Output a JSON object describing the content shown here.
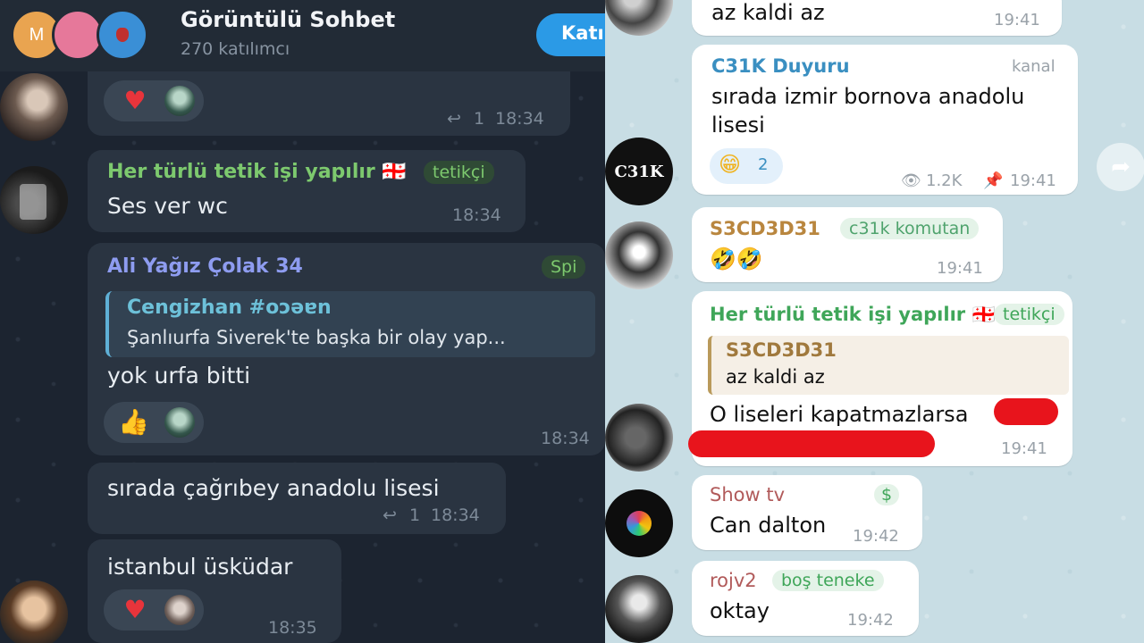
{
  "left": {
    "header": {
      "title": "Görüntülü Sohbet",
      "subtitle": "270 katılımcı",
      "join_label": "Katıl",
      "avatar_letter": "M"
    },
    "messages": [
      {
        "reply_count": "1",
        "time": "18:34"
      },
      {
        "sender": "Her türlü tetik işi yapılır 🇬🇪",
        "tag": "tetikçi",
        "text": "Ses ver wc",
        "time": "18:34"
      },
      {
        "sender": "Ali Yağız Çolak 34",
        "tag": "Spi",
        "quote_sender": "Cengizhan #oɔəɐn",
        "quote_text": "Şanlıurfa Siverek'te başka bir olay yap...",
        "text": "yok urfa bitti",
        "time": "18:34"
      },
      {
        "text": "sırada çağrıbey anadolu lisesi",
        "reply_count": "1",
        "time": "18:34"
      },
      {
        "text": "istanbul üsküdar",
        "time": "18:35"
      }
    ]
  },
  "right": {
    "messages": [
      {
        "text": "az kaldi az",
        "time": "19:41"
      },
      {
        "sender": "C31K Duyuru",
        "tag": "kanal",
        "text_line1": "sırada izmir bornova anadolu",
        "text_line2": "lisesi",
        "reaction_emoji": "😁",
        "reaction_count": "2",
        "views": "1.2K",
        "time": "19:41",
        "avatar_label": "C31K"
      },
      {
        "sender": "S3CD3D31",
        "tag": "c31k komutan",
        "text": "🤣🤣",
        "time": "19:41"
      },
      {
        "sender": "Her türlü tetik işi yapılır 🇬🇪",
        "tag": "tetikçi",
        "quote_sender": "S3CD3D31",
        "quote_text": "az kaldi az",
        "text": "O liseleri kapatmazlarsa",
        "time": "19:41"
      },
      {
        "sender": "Show tv",
        "tag": "$",
        "text": "Can dalton",
        "time": "19:42"
      },
      {
        "sender": "rojv2",
        "tag": "boş teneke",
        "text": "oktay",
        "time": "19:42"
      }
    ]
  },
  "colors": {
    "dark_bg": "#1c2430",
    "dark_bubble": "#2a3441",
    "light_bg": "#c8dde4",
    "accent_blue": "#2b9ae6",
    "name_green": "#7dc96e",
    "name_purple": "#8e9cf0",
    "redaction_red": "#e8141c"
  },
  "icons": [
    "reply-arrow-icon",
    "eye-icon",
    "pin-icon",
    "share-icon",
    "heart-emoji",
    "thumbs-up-emoji"
  ]
}
